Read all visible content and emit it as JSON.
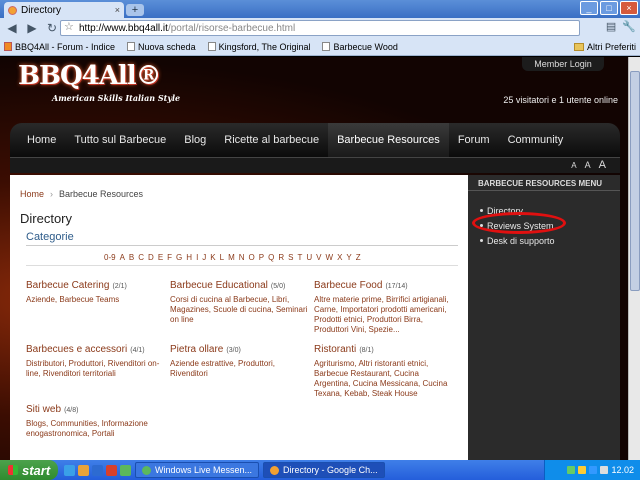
{
  "browser": {
    "tab_title": "Directory",
    "new_tab": "+",
    "window_buttons": [
      "_",
      "□",
      "×"
    ],
    "url_host": "http://www.bbq4all.it",
    "url_path": "/portal/risorse-barbecue.html",
    "bookmarks": [
      "BBQ4All - Forum - Indice",
      "Nuova scheda",
      "Kingsford, The Original",
      "Barbecue Wood"
    ],
    "other_bookmarks": "Altri Preferiti"
  },
  "site": {
    "logo": "BBQ4All®",
    "tagline": "American Skills Italian Style",
    "member_login": "Member Login",
    "visitors": "25 visitatori e 1 utente online",
    "nav": [
      "Home",
      "Tutto sul Barbecue",
      "Blog",
      "Ricette al barbecue",
      "Barbecue Resources",
      "Forum",
      "Community"
    ],
    "active_nav_index": 4,
    "font_sizes": [
      "A",
      "A",
      "A"
    ]
  },
  "content": {
    "breadcrumb_home": "Home",
    "breadcrumb_sep": "›",
    "breadcrumb_current": "Barbecue Resources",
    "title": "Directory",
    "section": "Categorie",
    "alphabet": [
      "0-9",
      "A",
      "B",
      "C",
      "D",
      "E",
      "F",
      "G",
      "H",
      "I",
      "J",
      "K",
      "L",
      "M",
      "N",
      "O",
      "P",
      "Q",
      "R",
      "S",
      "T",
      "U",
      "V",
      "W",
      "X",
      "Y",
      "Z"
    ],
    "categories": [
      {
        "name": "Barbecue Catering",
        "count": "(2/1)",
        "subs": "Aziende, Barbecue Teams"
      },
      {
        "name": "Barbecue Educational",
        "count": "(5/0)",
        "subs": "Corsi di cucina al Barbecue, Libri, Magazines, Scuole di cucina, Seminari on line"
      },
      {
        "name": "Barbecue Food",
        "count": "(17/14)",
        "subs": "Altre materie prime, Birrifici artigianali, Carne, Importatori prodotti americani, Prodotti etnici, Produttori Birra, Produttori Vini, Spezie..."
      },
      {
        "name": "Barbecues e accessori",
        "count": "(4/1)",
        "subs": "Distributori, Produttori, Rivenditori on-line, Rivenditori territoriali"
      },
      {
        "name": "Pietra ollare",
        "count": "(3/0)",
        "subs": "Aziende estrattive, Produttori, Rivenditori"
      },
      {
        "name": "Ristoranti",
        "count": "(8/1)",
        "subs": "Agriturismo, Altri ristoranti etnici, Barbecue Restaurant, Cucina Argentina, Cucina Messicana, Cucina Texana, Kebab, Steak House"
      },
      {
        "name": "Siti web",
        "count": "(4/8)",
        "subs": "Blogs, Communities, Informazione enogastronomica, Portali"
      }
    ]
  },
  "sidebar": {
    "title": "BARBECUE RESOURCES MENU",
    "items": [
      "Directory",
      "Reviews System",
      "Desk di supporto"
    ]
  },
  "taskbar": {
    "start": "start",
    "tasks": [
      "Windows Live Messen...",
      "Directory - Google Ch..."
    ],
    "clock": "12.02"
  }
}
